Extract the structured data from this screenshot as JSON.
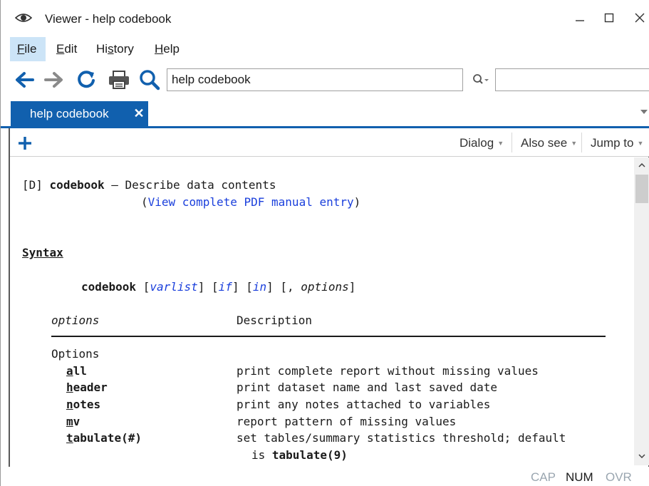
{
  "window": {
    "title": "Viewer - help codebook",
    "icon": "eye-icon",
    "controls": [
      "minimize",
      "maximize",
      "close"
    ]
  },
  "menu": {
    "file": {
      "u": "F",
      "rest": "ile"
    },
    "edit": {
      "u": "E",
      "rest": "dit"
    },
    "history": {
      "pre": "Hi",
      "u": "s",
      "rest": "tory"
    },
    "help": {
      "u": "H",
      "rest": "elp"
    }
  },
  "toolbar": {
    "url_value": "help codebook",
    "find_value": ""
  },
  "tab": {
    "label": "help codebook",
    "close": "✕"
  },
  "docbar": {
    "dialog": "Dialog",
    "also_see": "Also see",
    "jump_to": "Jump to"
  },
  "content": {
    "header_ref": "[D]",
    "header_cmd": "codebook",
    "header_dash": "—",
    "header_desc": "Describe data contents",
    "pdf_open": "(",
    "pdf_link": "View complete PDF manual entry",
    "pdf_close": ")",
    "syntax_heading": "Syntax",
    "syntax": {
      "cmd": "codebook",
      "varlist": "varlist",
      "if": "if",
      "in": "in",
      "options": "options"
    },
    "table_head_options": "options",
    "table_head_description": "Description",
    "group_label": "Options",
    "rows": [
      {
        "u": "a",
        "rest": "ll",
        "desc": "print complete report without missing values"
      },
      {
        "u": "h",
        "rest": "eader",
        "desc": "print dataset name and last saved date"
      },
      {
        "u": "n",
        "rest": "otes",
        "desc": "print any notes attached to variables"
      },
      {
        "u": "m",
        "rest": "v",
        "desc": "report pattern of missing values"
      },
      {
        "u": "t",
        "rest": "abulate(#)",
        "desc": "set tables/summary statistics threshold; default"
      }
    ],
    "cont_prefix": "is",
    "cont_value": "tabulate(9)"
  },
  "status": {
    "cap": "CAP",
    "num": "NUM",
    "ovr": "OVR"
  },
  "colors": {
    "accent": "#1160ae",
    "link": "#1a3fdc",
    "menu_active": "#cce4f7"
  }
}
